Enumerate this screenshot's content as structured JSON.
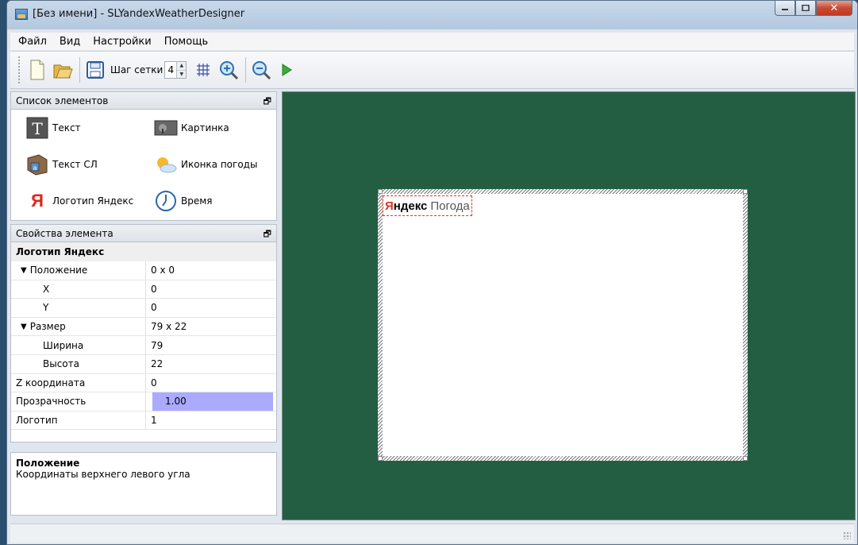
{
  "window": {
    "title": "[Без имени] - SLYandexWeatherDesigner"
  },
  "menu": {
    "items": [
      "Файл",
      "Вид",
      "Настройки",
      "Помощь"
    ]
  },
  "toolbar": {
    "grid_label": "Шаг сетки",
    "grid_step": "4",
    "icons": [
      "new-file-icon",
      "open-folder-icon",
      "save-icon",
      "grid-icon",
      "zoom-in-icon",
      "zoom-out-icon",
      "play-icon"
    ]
  },
  "elements_panel": {
    "title": "Список элементов",
    "items": [
      {
        "label": "Текст",
        "icon": "text-icon"
      },
      {
        "label": "Картинка",
        "icon": "picture-icon"
      },
      {
        "label": "Текст СЛ",
        "icon": "text-sl-icon"
      },
      {
        "label": "Иконка погоды",
        "icon": "weather-icon"
      },
      {
        "label": "Логотип Яндекс",
        "icon": "yandex-logo-icon"
      },
      {
        "label": "Время",
        "icon": "clock-icon"
      }
    ]
  },
  "properties_panel": {
    "title": "Свойства элемента",
    "element_name": "Логотип Яндекс",
    "rows": [
      {
        "key": "Положение",
        "value": "0 x 0",
        "kind": "group"
      },
      {
        "key": "X",
        "value": "0",
        "kind": "child"
      },
      {
        "key": "Y",
        "value": "0",
        "kind": "child"
      },
      {
        "key": "Размер",
        "value": "79 x 22",
        "kind": "group"
      },
      {
        "key": "Ширина",
        "value": "79",
        "kind": "child"
      },
      {
        "key": "Высота",
        "value": "22",
        "kind": "child"
      },
      {
        "key": "Z координата",
        "value": "0",
        "kind": "plain"
      },
      {
        "key": "Прозрачность",
        "value": "1.00",
        "kind": "plain",
        "selected": true
      },
      {
        "key": "Логотип",
        "value": "1",
        "kind": "plain"
      }
    ]
  },
  "description": {
    "title": "Положение",
    "text": "Координаты верхнего левого угла"
  },
  "canvas": {
    "logo_ya": "Я",
    "logo_ndex": "ндекс",
    "logo_pogoda": "Погода",
    "background": "#235e43"
  }
}
